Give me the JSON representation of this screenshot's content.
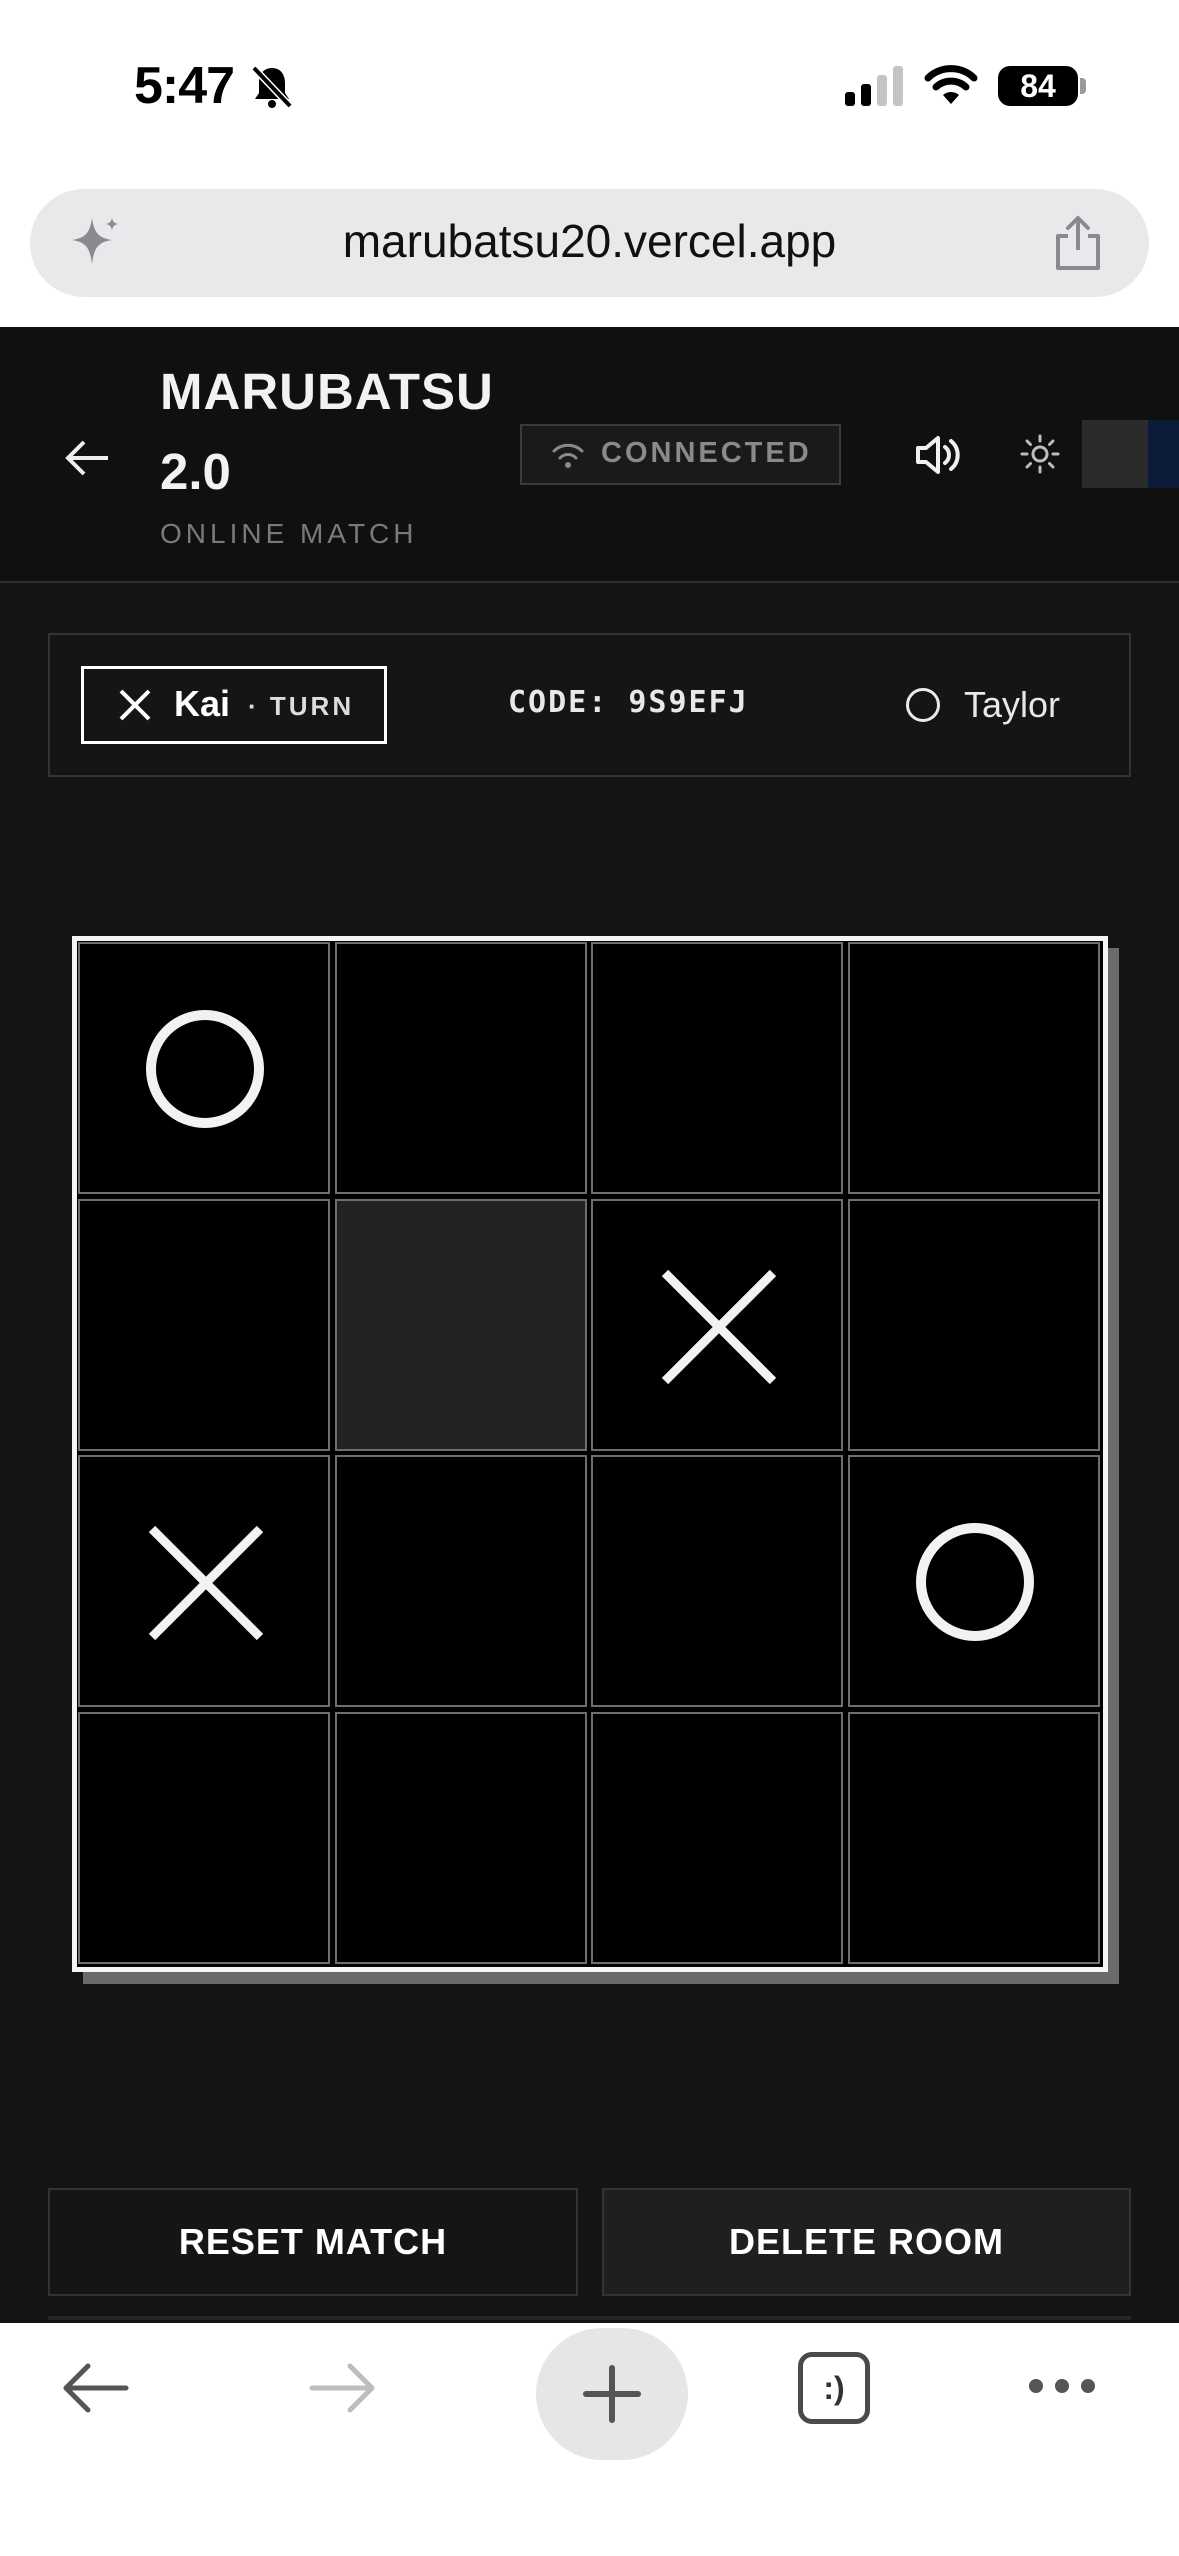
{
  "status_bar": {
    "time": "5:47",
    "battery": "84"
  },
  "browser": {
    "url": "marubatsu20.vercel.app",
    "tabs_label": ":)"
  },
  "header": {
    "title_line1": "MARUBATSU",
    "title_line2": "2.0",
    "subtitle": "ONLINE MATCH",
    "connection": "CONNECTED"
  },
  "players": {
    "player_x": {
      "mark": "X",
      "name": "Kai",
      "turn_label": "· TURN"
    },
    "room_code": "CODE: 9S9EFJ",
    "player_o": {
      "mark": "O",
      "name": "Taylor"
    }
  },
  "board": {
    "cells": [
      [
        "O",
        "",
        "",
        ""
      ],
      [
        "",
        "",
        "X",
        ""
      ],
      [
        "X",
        "",
        "",
        "O"
      ],
      [
        "",
        "",
        "",
        ""
      ]
    ],
    "highlighted_cell": [
      1,
      1
    ]
  },
  "actions": {
    "reset": "RESET MATCH",
    "delete": "DELETE ROOM"
  },
  "colors": {
    "background": "#141414",
    "board": "#000000",
    "mark": "#f2f2f2",
    "accent_toggle": "#0d1b3a"
  }
}
